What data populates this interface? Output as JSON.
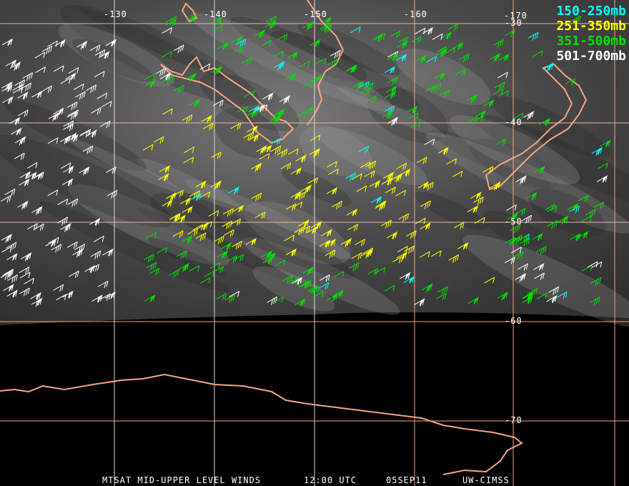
{
  "longitude_labels": [
    "-130",
    "-140",
    "-150",
    "-160",
    "-170"
  ],
  "latitude_labels": [
    "-30",
    "-40",
    "-50",
    "-60",
    "-70"
  ],
  "legend": [
    {
      "label": "150-250mb",
      "color": "#00ffff"
    },
    {
      "label": "251-350mb",
      "color": "#ffff00"
    },
    {
      "label": "351-500mb",
      "color": "#00e000"
    },
    {
      "label": "501-700mb",
      "color": "#ffffff"
    }
  ],
  "caption": {
    "product": "MTSAT MID-UPPER LEVEL WINDS",
    "time": "12:00 UTC",
    "date": "05SEP11",
    "source": "UW-CIMSS"
  },
  "colors": {
    "coastline": "#f4a582",
    "grid_light": "#d8d8d8",
    "grid_orange": "#f4a582"
  }
}
